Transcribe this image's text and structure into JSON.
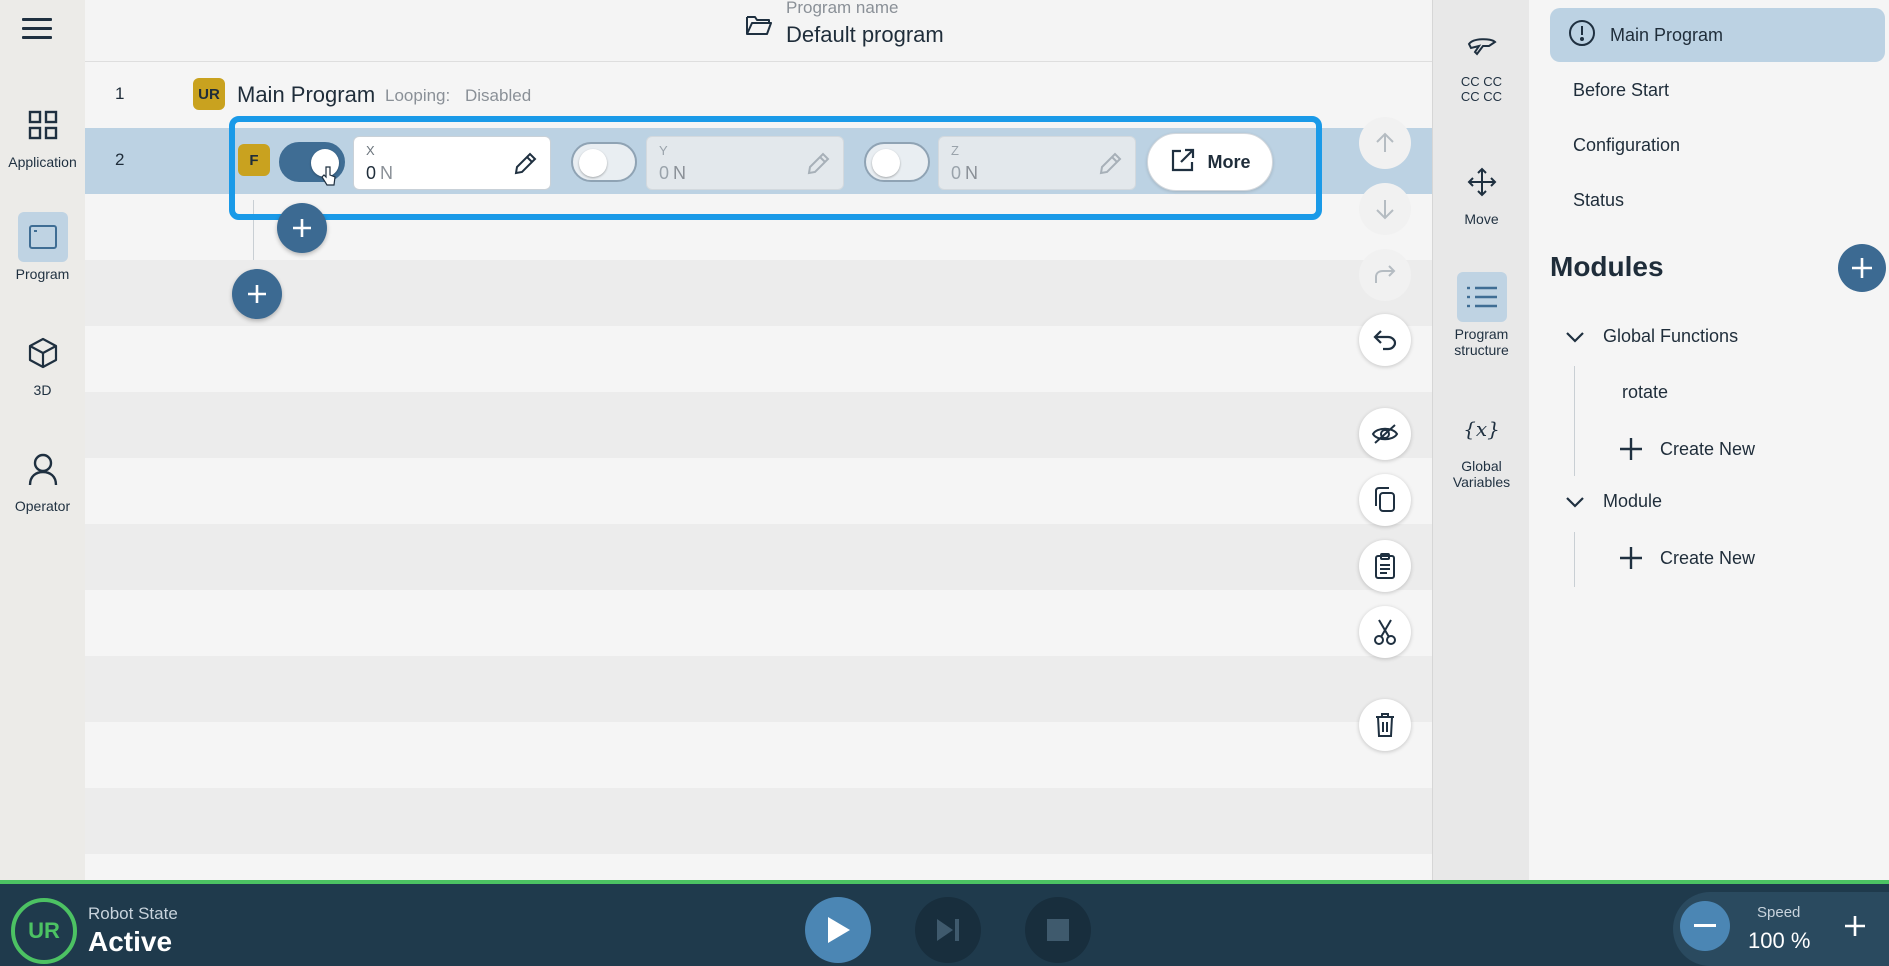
{
  "leftnav": {
    "items": [
      {
        "label": "Application",
        "icon": "grid-icon"
      },
      {
        "label": "Program",
        "icon": "program-window-icon"
      },
      {
        "label": "3D",
        "icon": "cube-icon"
      },
      {
        "label": "Operator",
        "icon": "person-icon"
      }
    ]
  },
  "header": {
    "program_name_label": "Program name",
    "program_name": "Default program"
  },
  "program": {
    "rows": [
      {
        "num": "1",
        "title": "Main Program",
        "looping_label": "Looping:",
        "looping_value": "Disabled"
      },
      {
        "num": "2",
        "badge": "F"
      }
    ],
    "force": {
      "x": {
        "label": "X",
        "value": "0",
        "unit": "N",
        "enabled": true
      },
      "y": {
        "label": "Y",
        "value": "0",
        "unit": "N",
        "enabled": false
      },
      "z": {
        "label": "Z",
        "value": "0",
        "unit": "N",
        "enabled": false
      },
      "more_label": "More"
    }
  },
  "tools": {
    "items": [
      {
        "label_line1": "CC CC",
        "label_line2": "CC CC"
      },
      {
        "label_line1": "Move",
        "label_line2": ""
      },
      {
        "label_line1": "Program",
        "label_line2": "structure"
      },
      {
        "label_line1": "Global",
        "label_line2": "Variables"
      }
    ]
  },
  "rightpanel": {
    "main_program": "Main Program",
    "before_start": "Before Start",
    "configuration": "Configuration",
    "status": "Status",
    "modules_title": "Modules",
    "groups": [
      {
        "label": "Global Functions",
        "children": [
          "rotate"
        ],
        "create_label": "Create New"
      },
      {
        "label": "Module",
        "children": [],
        "create_label": "Create New"
      }
    ]
  },
  "footer": {
    "robot_state_label": "Robot State",
    "robot_state_value": "Active",
    "speed_label": "Speed",
    "speed_value": "100 %"
  },
  "colors": {
    "accent": "#3c6a92",
    "highlight": "#1a9ae8",
    "status_green": "#4cc263",
    "footer_bg": "#1f3a4c"
  }
}
